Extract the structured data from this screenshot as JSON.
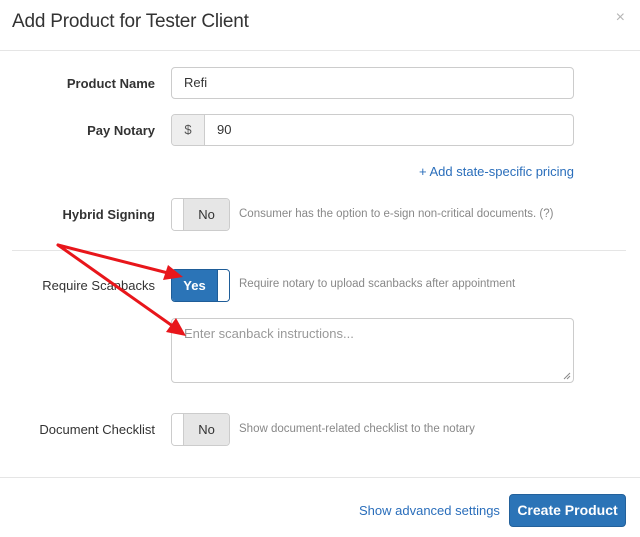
{
  "modal": {
    "title": "Add Product for Tester Client",
    "close_icon": "×"
  },
  "form": {
    "product_name": {
      "label": "Product Name",
      "value": "Refi"
    },
    "pay_notary": {
      "label": "Pay Notary",
      "currency_symbol": "$",
      "value": "90"
    },
    "add_state_pricing_link": "+ Add state-specific pricing",
    "hybrid_signing": {
      "label": "Hybrid Signing",
      "state": "No",
      "enabled": false,
      "help": "Consumer has the option to e-sign non-critical documents. (?)"
    },
    "require_scanbacks": {
      "label": "Require Scanbacks",
      "state": "Yes",
      "enabled": true,
      "help": "Require notary to upload scanbacks after appointment",
      "instructions_placeholder": "Enter scanback instructions..."
    },
    "document_checklist": {
      "label": "Document Checklist",
      "state": "No",
      "enabled": false,
      "help": "Show document-related checklist to the notary"
    }
  },
  "footer": {
    "advanced_link": "Show advanced settings",
    "create_button": "Create Product"
  },
  "colors": {
    "primary": "#2b74b7",
    "link": "#2a6ebb",
    "annotation_arrow": "#e8161b"
  }
}
